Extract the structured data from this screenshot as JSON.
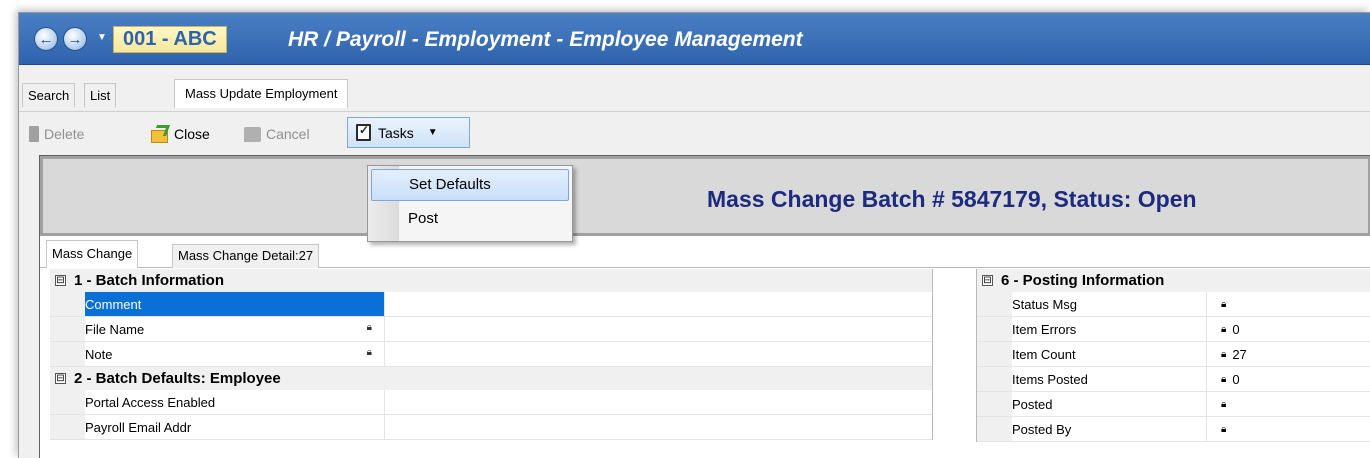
{
  "titlebar": {
    "company": "001 - ABC",
    "title": "HR / Payroll - Employment - Employee Management"
  },
  "tabs": [
    {
      "label": "Search"
    },
    {
      "label": "List"
    },
    {
      "label": "Mass Update Employment"
    }
  ],
  "toolbar": {
    "delete_label": "Delete",
    "close_label": "Close",
    "cancel_label": "Cancel",
    "tasks_label": "Tasks"
  },
  "tasks_menu": [
    {
      "label": "Set Defaults"
    },
    {
      "label": "Post"
    }
  ],
  "banner": "Mass Change Batch # 5847179, Status: Open",
  "subtabs": [
    {
      "label": "Mass Change"
    },
    {
      "label": "Mass Change Detail:27"
    }
  ],
  "left_grid": {
    "section1": "1 - Batch Information",
    "rows1": [
      {
        "name": "Comment",
        "value": ""
      },
      {
        "name": "File Name",
        "value": ""
      },
      {
        "name": "Note",
        "value": ""
      }
    ],
    "section2": "2 - Batch Defaults: Employee",
    "rows2": [
      {
        "name": "Portal Access Enabled",
        "value": ""
      },
      {
        "name": "Payroll Email Addr",
        "value": ""
      }
    ]
  },
  "right_grid": {
    "section": "6 - Posting Information",
    "rows": [
      {
        "name": "Status Msg",
        "value": ""
      },
      {
        "name": "Item Errors",
        "value": "0"
      },
      {
        "name": "Item Count",
        "value": "27"
      },
      {
        "name": "Items Posted",
        "value": "0"
      },
      {
        "name": "Posted",
        "value": ""
      },
      {
        "name": "Posted By",
        "value": ""
      }
    ]
  },
  "icons": {
    "expand": "⊟",
    "lock": "🔒"
  },
  "colors": {
    "titlebar": "#2f64ad",
    "selected_row": "#0a6fd6",
    "banner_text": "#1c2a80"
  }
}
